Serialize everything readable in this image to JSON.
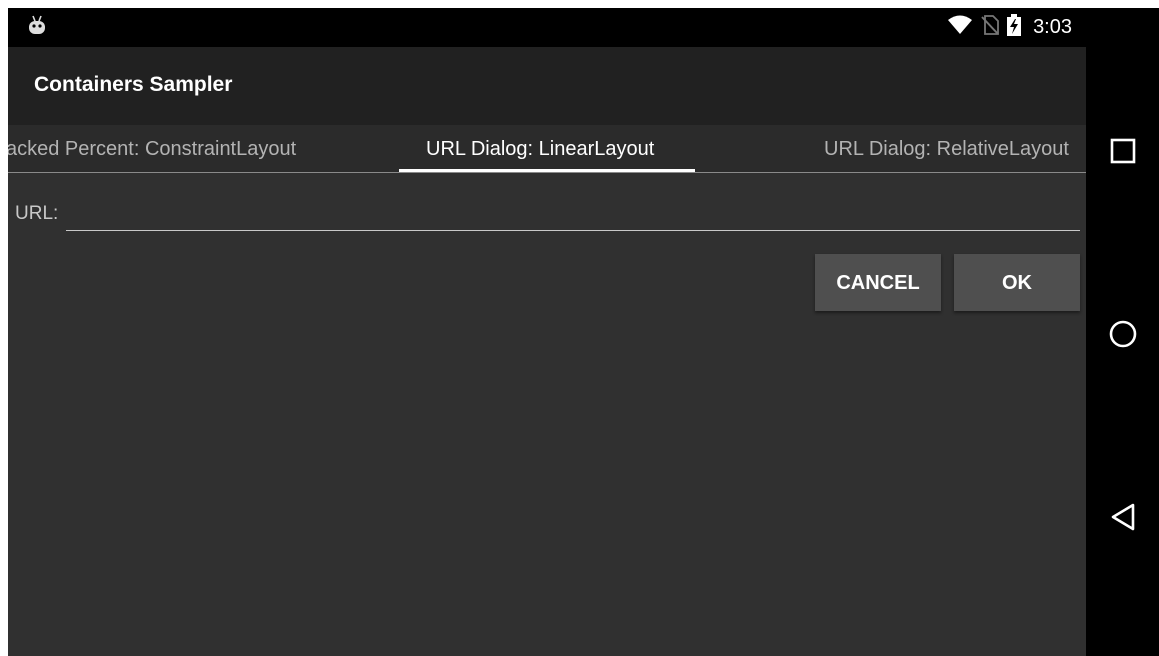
{
  "statusbar": {
    "time": "3:03",
    "icons": [
      "android-debug-icon",
      "wifi-icon",
      "no-sim-icon",
      "battery-charging-icon"
    ]
  },
  "appbar": {
    "title": "Containers Sampler"
  },
  "tabs": [
    {
      "label": "acked Percent: ConstraintLayout",
      "active": false
    },
    {
      "label": "URL Dialog: LinearLayout",
      "active": true
    },
    {
      "label": "URL Dialog: RelativeLayout",
      "active": false
    }
  ],
  "form": {
    "url_label": "URL:",
    "url_value": "",
    "url_placeholder": ""
  },
  "buttons": {
    "cancel": "CANCEL",
    "ok": "OK"
  },
  "navbar": {
    "icons": [
      "recents-icon",
      "home-icon",
      "back-icon"
    ]
  },
  "colors": {
    "background": "#303030",
    "appbar": "#212121",
    "tabbar": "#2b2b2b",
    "button": "#4f4f4f",
    "indicator": "#ffffff"
  }
}
